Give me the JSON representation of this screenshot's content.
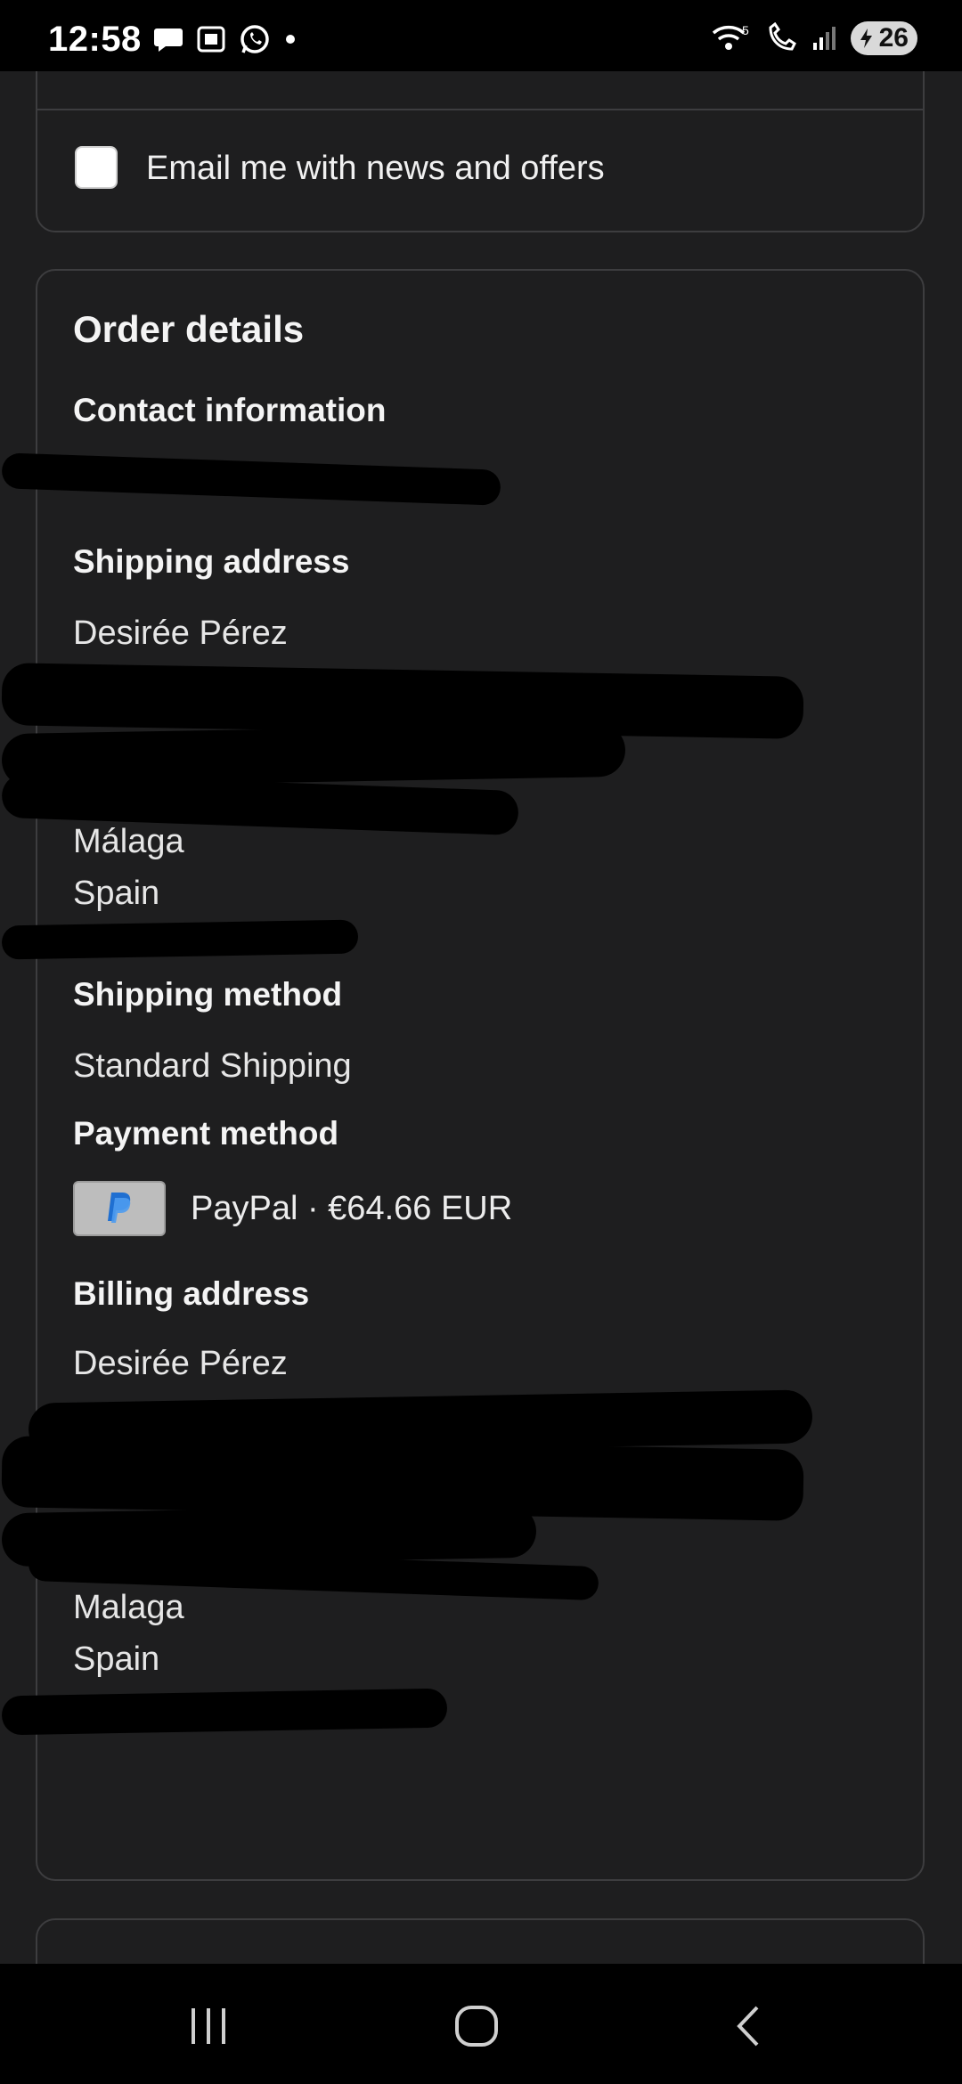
{
  "status_bar": {
    "time": "12:58",
    "battery": "26",
    "left_icons": [
      "chat-icon",
      "screenshot-icon",
      "whatsapp-icon",
      "dot-icon"
    ],
    "right_icons": [
      "wifi-calling-icon",
      "wifi-call-icon",
      "signal-icon",
      "battery-icon"
    ]
  },
  "newsletter": {
    "checkbox_label": "Email me with news and offers",
    "checked": false
  },
  "order": {
    "title": "Order details",
    "contact_heading": "Contact information",
    "shipping_address_heading": "Shipping address",
    "shipping_address": {
      "name": "Desirée Pérez",
      "city": "Málaga",
      "country": "Spain"
    },
    "shipping_method_heading": "Shipping method",
    "shipping_method": "Standard Shipping",
    "payment_method_heading": "Payment method",
    "payment_method": "PayPal · €64.66 EUR",
    "billing_address_heading": "Billing address",
    "billing_address": {
      "name": "Desirée Pérez",
      "city": "Malaga",
      "country": "Spain"
    }
  },
  "nav": {
    "recents": "recents-icon",
    "home": "home-icon",
    "back": "back-icon"
  }
}
